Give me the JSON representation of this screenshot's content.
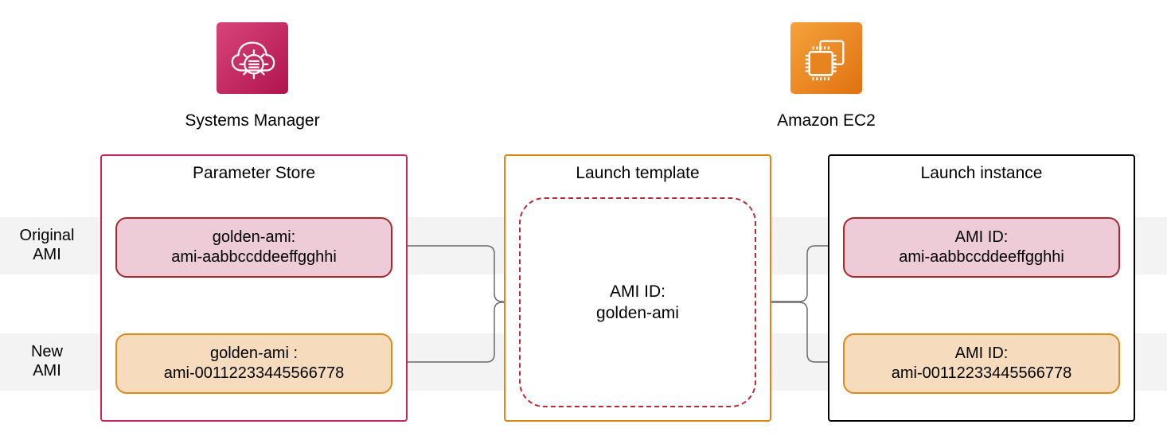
{
  "services": {
    "systems_manager": "Systems Manager",
    "ec2": "Amazon EC2"
  },
  "row_labels": {
    "original": "Original\nAMI",
    "new": "New\nAMI"
  },
  "panels": {
    "parameter_store": "Parameter Store",
    "launch_template": "Launch template",
    "launch_instance": "Launch instance"
  },
  "parameter_store": {
    "original": {
      "key": "golden-ami:",
      "value": "ami-aabbccddeeffgghhi"
    },
    "new": {
      "key": "golden-ami :",
      "value": "ami-00112233445566778"
    }
  },
  "launch_template": {
    "line1": "AMI ID:",
    "line2": "golden-ami"
  },
  "launch_instance": {
    "original": {
      "key": "AMI ID:",
      "value": "ami-aabbccddeeffgghhi"
    },
    "new": {
      "key": "AMI ID:",
      "value": "ami-00112233445566778"
    }
  },
  "colors": {
    "panel_red": "#c42760",
    "panel_orange": "#dd8515",
    "panel_black": "#000000"
  }
}
